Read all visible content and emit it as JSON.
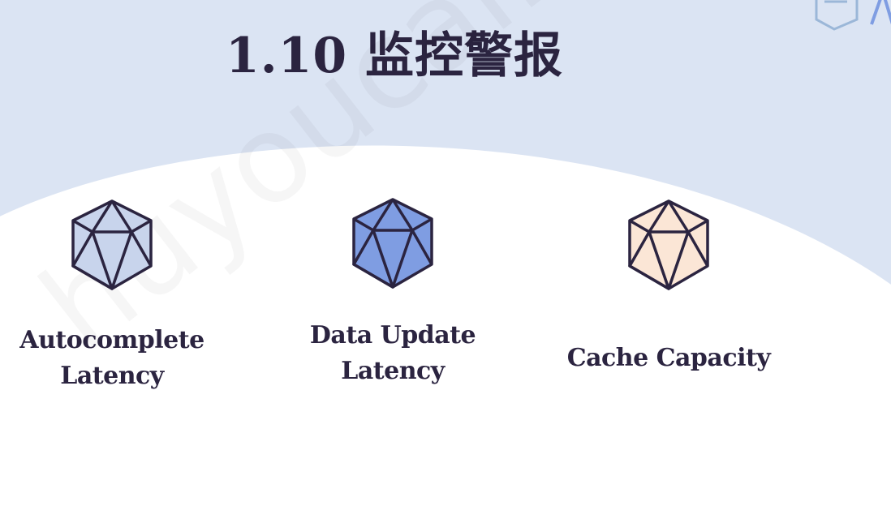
{
  "slide": {
    "title": "1.10 监控警报",
    "watermark": "huyoucai.huxin"
  },
  "metrics": [
    {
      "label_line1": "Autocomplete",
      "label_line2": "Latency",
      "color": "#c8d4ec"
    },
    {
      "label_line1": "Data Update",
      "label_line2": "Latency",
      "color": "#7f9de2"
    },
    {
      "label_line1": "Cache Capacity",
      "label_line2": "",
      "color": "#fbe6d6"
    }
  ],
  "colors": {
    "ink": "#2b2440",
    "top_band": "#dbe4f3",
    "arc": "#ffffff"
  }
}
